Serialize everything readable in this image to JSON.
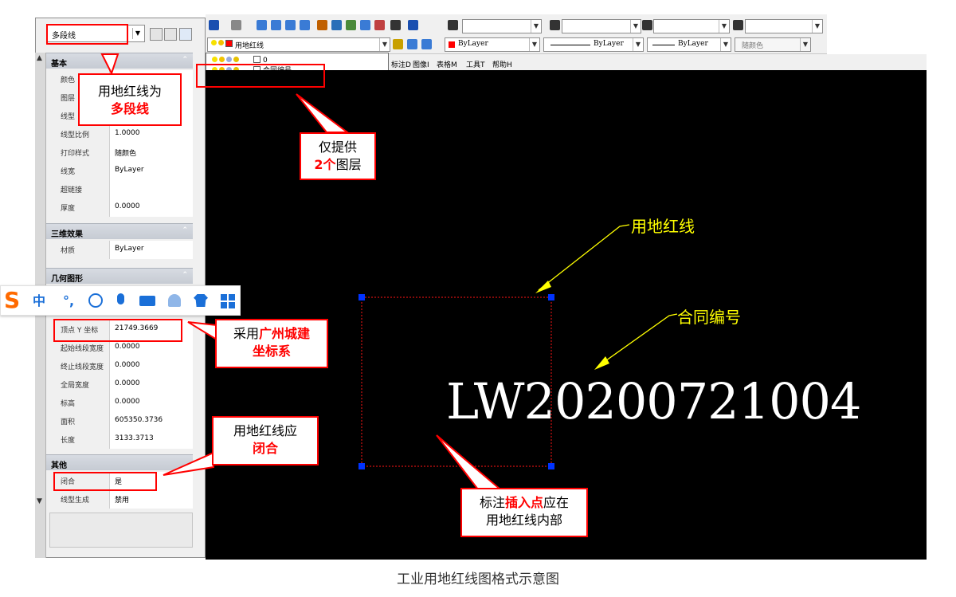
{
  "properties": {
    "object_type": "多段线",
    "sections": {
      "basic": {
        "title": "基本",
        "rows": [
          {
            "key": "颜色",
            "value": ""
          },
          {
            "key": "图层",
            "value": ""
          },
          {
            "key": "线型",
            "value": ""
          },
          {
            "key": "线型比例",
            "value": "1.0000"
          },
          {
            "key": "打印样式",
            "value": "随颜色"
          },
          {
            "key": "线宽",
            "value": "ByLayer"
          },
          {
            "key": "超链接",
            "value": ""
          },
          {
            "key": "厚度",
            "value": "0.0000"
          }
        ]
      },
      "three_d": {
        "title": "三维效果",
        "rows": [
          {
            "key": "材质",
            "value": "ByLayer"
          }
        ]
      },
      "geometry": {
        "title": "几何图形",
        "rows": [
          {
            "key": "顶点 Y 坐标",
            "value": "21749.3669"
          },
          {
            "key": "起始线段宽度",
            "value": "0.0000"
          },
          {
            "key": "终止线段宽度",
            "value": "0.0000"
          },
          {
            "key": "全局宽度",
            "value": "0.0000"
          },
          {
            "key": "标高",
            "value": "0.0000"
          },
          {
            "key": "面积",
            "value": "605350.3736"
          },
          {
            "key": "长度",
            "value": "3133.3713"
          }
        ]
      },
      "other": {
        "title": "其他",
        "rows": [
          {
            "key": "闭合",
            "value": "是"
          },
          {
            "key": "线型生成",
            "value": "禁用"
          }
        ]
      }
    }
  },
  "toolbar": {
    "current_layer": "用地红线",
    "color_select": "ByLayer",
    "linetype_select": "ByLayer",
    "lineweight_select": "ByLayer",
    "plotstyle_select": "随颜色"
  },
  "layer_list": [
    {
      "name": "0",
      "color": "#ffffff"
    },
    {
      "name": "合同编号",
      "color": "#ffffff"
    },
    {
      "name": "用地红线",
      "color": "#ff0000"
    }
  ],
  "menu": [
    "标注D",
    "图像I",
    "表格M",
    "工具T",
    "帮助H"
  ],
  "drawing": {
    "contract_text": "LW20200721004",
    "label_red_line": "用地红线",
    "label_contract": "合同编号"
  },
  "callouts": {
    "polyline": {
      "line1": "用地红线为",
      "line2": "多段线"
    },
    "layers": {
      "line1": "仅提供",
      "line2_red": "2个",
      "line2_rest": "图层"
    },
    "coords": {
      "prefix": "采用",
      "red": "广州城建",
      "line2_red": "坐标系"
    },
    "closed": {
      "line1": "用地红线应",
      "line2_red": "闭合"
    },
    "insert": {
      "prefix": "标注",
      "red": "插入点",
      "suffix": "应在",
      "line2": "用地红线内部"
    }
  },
  "ime": {
    "logo": "S",
    "mode": "中",
    "punct": "°,"
  },
  "caption": "工业用地红线图格式示意图",
  "colors": {
    "annotation_red": "#ff0000",
    "leader_yellow": "#ffff00",
    "canvas": "#000000",
    "grip": "#0033ff"
  }
}
